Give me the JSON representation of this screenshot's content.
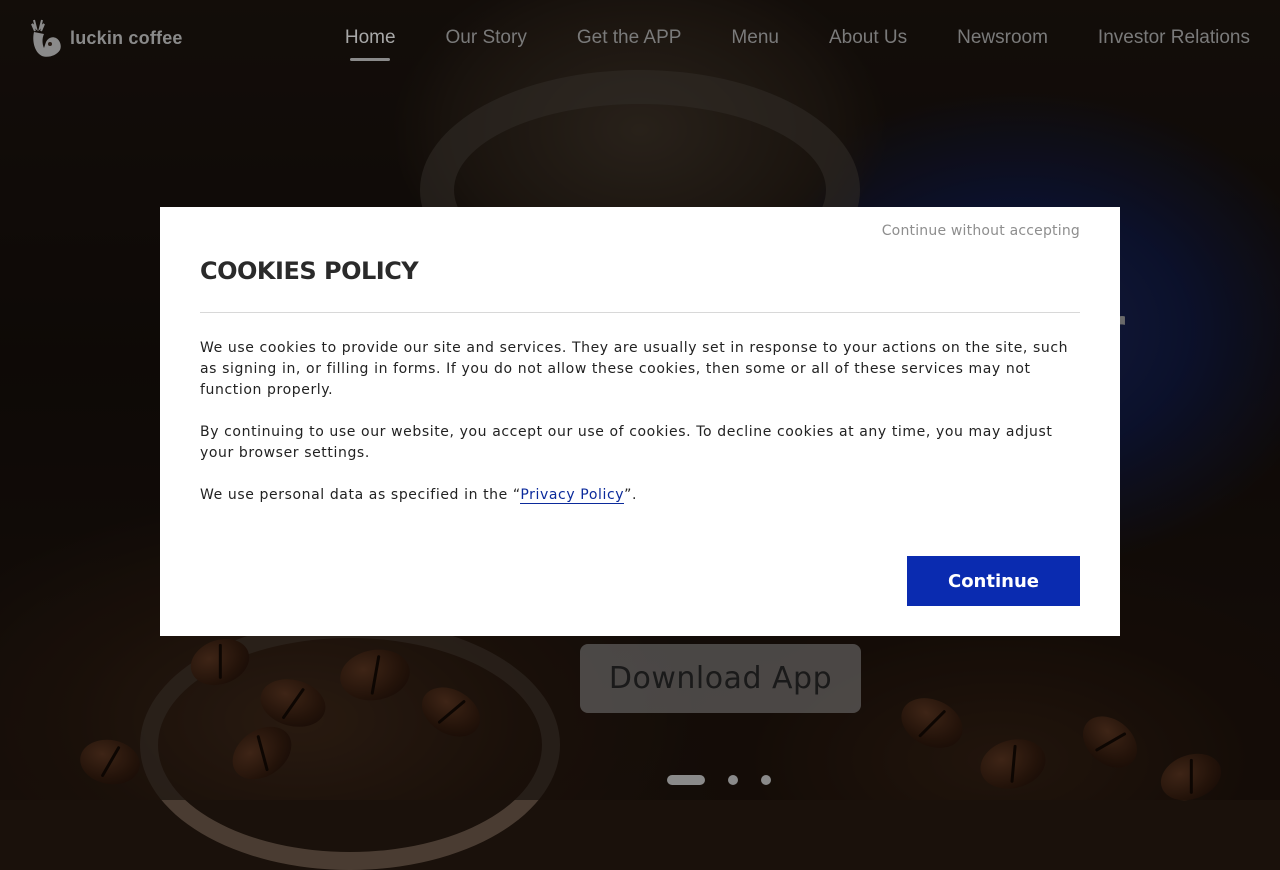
{
  "brand": {
    "logo_text": "luckin coffee",
    "logo_icon": "deer-icon"
  },
  "nav": {
    "items": [
      {
        "label": "Home",
        "active": true
      },
      {
        "label": "Our Story",
        "active": false
      },
      {
        "label": "Get the APP",
        "active": false
      },
      {
        "label": "Menu",
        "active": false
      },
      {
        "label": "About Us",
        "active": false
      },
      {
        "label": "Newsroom",
        "active": false
      },
      {
        "label": "Investor Relations",
        "active": false
      }
    ]
  },
  "hero": {
    "partial_text": "r",
    "download_label": "Download App",
    "carousel": {
      "count": 3,
      "active_index": 0
    }
  },
  "cookie_modal": {
    "skip_label": "Continue without accepting",
    "title": "COOKIES POLICY",
    "paragraph_1": "We use cookies to provide our site and services. They are usually set in response to your actions on the site, such as signing in, or filling in forms. If you do not allow these cookies, then some or all of these services may not function properly.",
    "paragraph_2": "By continuing to use our website, you accept our use of cookies. To decline cookies at any time, you may adjust your browser settings.",
    "paragraph_3_prefix": "We use personal data as specified in the “",
    "privacy_link_label": "Privacy Policy",
    "paragraph_3_suffix": "”.",
    "continue_label": "Continue",
    "accent_color": "#0a2bb0"
  }
}
